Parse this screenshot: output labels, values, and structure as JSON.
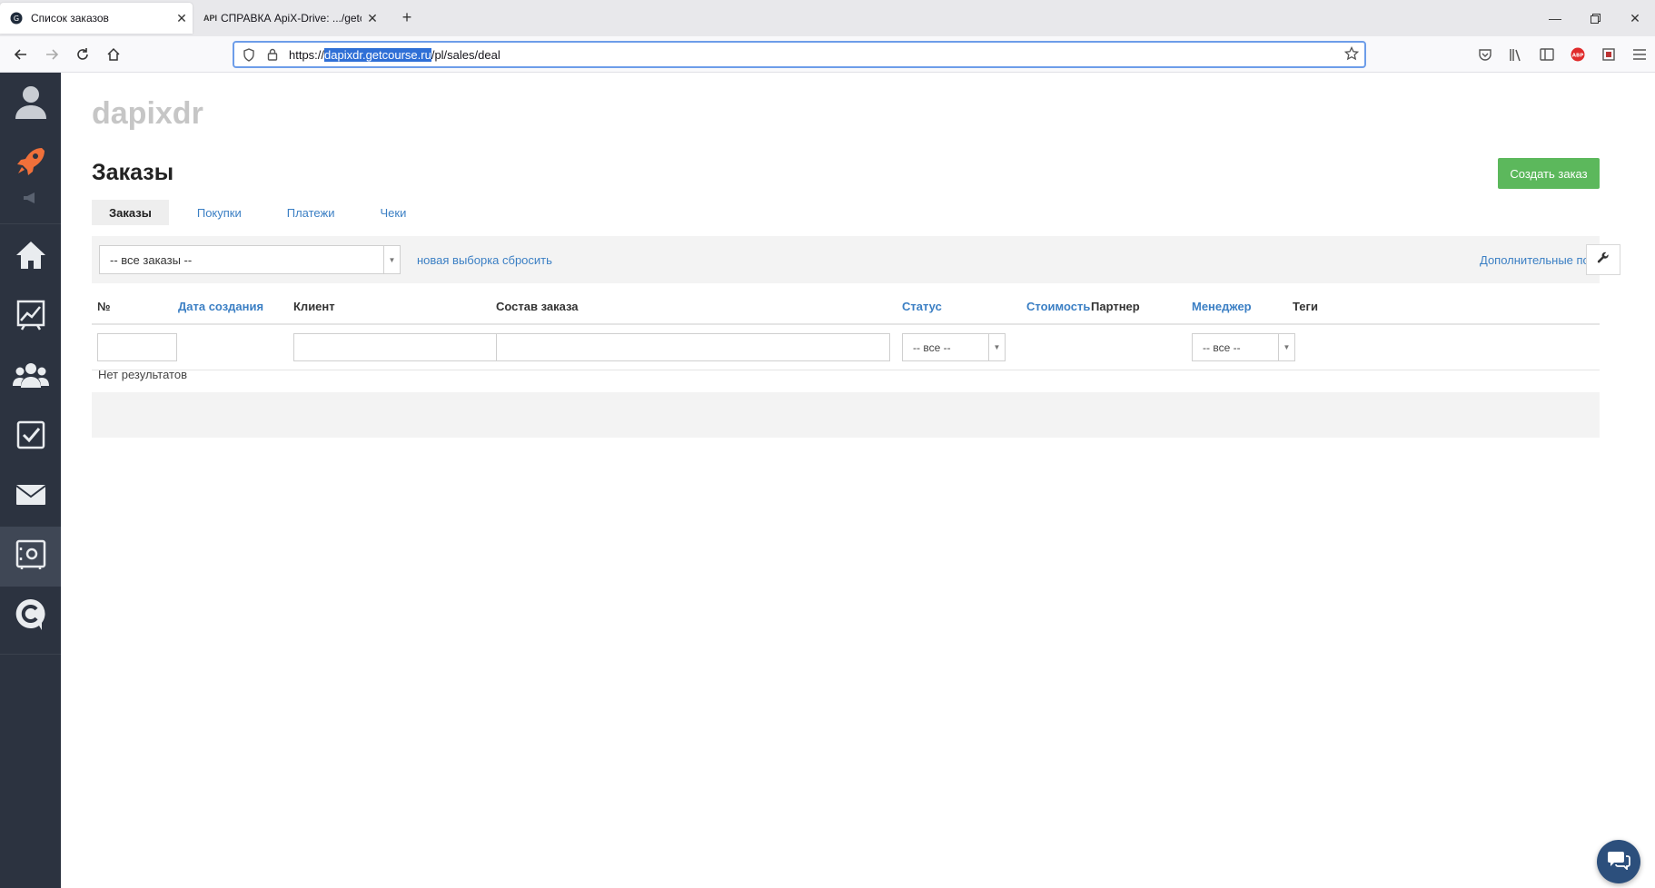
{
  "browser": {
    "tabs": [
      {
        "title": "Список заказов",
        "favicon": "getcourse-favicon",
        "active": true
      },
      {
        "title": "СПРАВКА ApiX-Drive: .../getco",
        "favicon": "api-favicon",
        "favicon_text": "API",
        "active": false
      }
    ],
    "new_tab_symbol": "+",
    "url": {
      "prefix": "https://",
      "highlighted": "dapixdr.getcourse.ru",
      "suffix": "/pl/sales/deal"
    }
  },
  "sidebar": {
    "items": [
      "user-avatar",
      "rocket",
      "megaphone",
      "home",
      "chart",
      "users",
      "tasks",
      "mail",
      "safe",
      "getcourse-logo"
    ],
    "active_item": "safe"
  },
  "header": {
    "school_name": "dapixdr",
    "title": "Заказы",
    "create_button": "Создать заказ",
    "create_button_color": "#5cb85c"
  },
  "subtabs": [
    {
      "label": "Заказы",
      "active": true
    },
    {
      "label": "Покупки",
      "active": false
    },
    {
      "label": "Платежи",
      "active": false
    },
    {
      "label": "Чеки",
      "active": false
    }
  ],
  "filters": {
    "segment_select": "-- все заказы --",
    "new_selection": "новая выборка",
    "reset": "сбросить",
    "extra_fields": "Дополнительные поля"
  },
  "table": {
    "columns": [
      {
        "label": "№",
        "sortable": false
      },
      {
        "label": "Дата создания",
        "sortable": true
      },
      {
        "label": "Клиент",
        "sortable": false
      },
      {
        "label": "Состав заказа",
        "sortable": false
      },
      {
        "label": "Статус",
        "sortable": true
      },
      {
        "label": "Стоимость",
        "sortable": true
      },
      {
        "label": "Партнер",
        "sortable": false
      },
      {
        "label": "Менеджер",
        "sortable": true
      },
      {
        "label": "Теги",
        "sortable": false
      }
    ],
    "status_filter": "-- все --",
    "manager_filter": "-- все --",
    "empty_message": "Нет результатов"
  },
  "colors": {
    "link": "#3b7fc4",
    "sidebar_bg": "#2c3340",
    "accent_orange": "#f0703a"
  }
}
